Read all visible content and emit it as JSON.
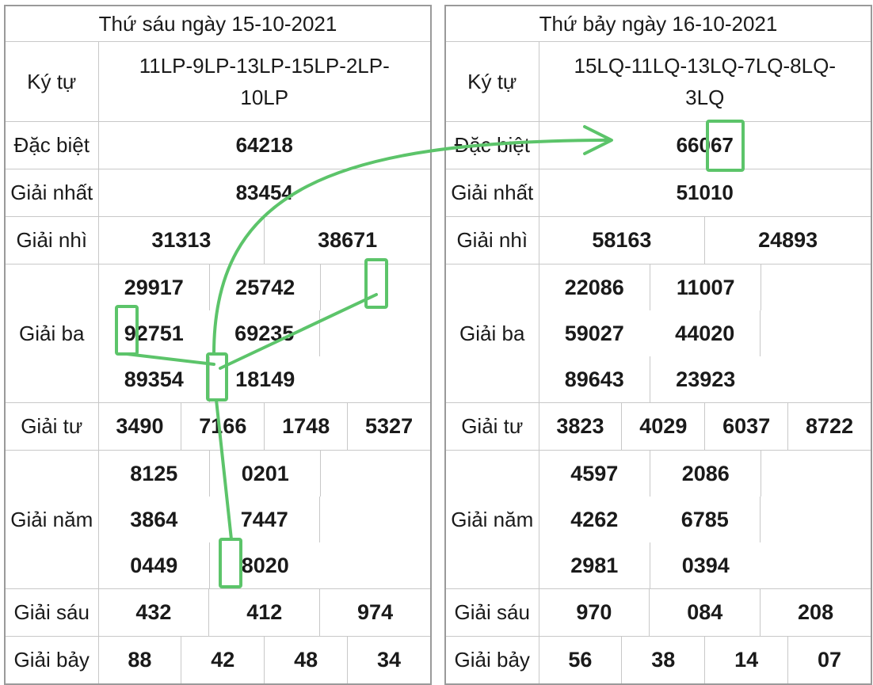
{
  "left": {
    "header": "Thứ sáu ngày 15-10-2021",
    "rows": {
      "kytu": {
        "label": "Ký tự",
        "codes": "11LP-9LP-13LP-15LP-2LP-10LP"
      },
      "dacbiet": {
        "label": "Đặc biệt",
        "values": [
          "64218"
        ]
      },
      "nhat": {
        "label": "Giải nhất",
        "values": [
          "83454"
        ]
      },
      "nhi": {
        "label": "Giải nhì",
        "values": [
          "31313",
          "38671"
        ]
      },
      "ba": {
        "label": "Giải ba",
        "values": [
          "29917",
          "25742",
          "92751",
          "69235",
          "89354",
          "18149"
        ]
      },
      "tu": {
        "label": "Giải tư",
        "values": [
          "3490",
          "7166",
          "1748",
          "5327"
        ]
      },
      "nam": {
        "label": "Giải năm",
        "values": [
          "8125",
          "0201",
          "3864",
          "7447",
          "0449",
          "8020"
        ]
      },
      "sau": {
        "label": "Giải sáu",
        "values": [
          "432",
          "412",
          "974"
        ]
      },
      "bay": {
        "label": "Giải bảy",
        "values": [
          "88",
          "42",
          "48",
          "34"
        ]
      }
    }
  },
  "right": {
    "header": "Thứ bảy ngày 16-10-2021",
    "rows": {
      "kytu": {
        "label": "Ký tự",
        "codes": "15LQ-11LQ-13LQ-7LQ-8LQ-3LQ"
      },
      "dacbiet": {
        "label": "Đặc biệt",
        "values": [
          "66067"
        ]
      },
      "nhat": {
        "label": "Giải nhất",
        "values": [
          "51010"
        ]
      },
      "nhi": {
        "label": "Giải nhì",
        "values": [
          "58163",
          "24893"
        ]
      },
      "ba": {
        "label": "Giải ba",
        "values": [
          "22086",
          "11007",
          "59027",
          "44020",
          "89643",
          "23923"
        ]
      },
      "tu": {
        "label": "Giải tư",
        "values": [
          "3823",
          "4029",
          "6037",
          "8722"
        ]
      },
      "nam": {
        "label": "Giải năm",
        "values": [
          "4597",
          "2086",
          "4262",
          "6785",
          "2981",
          "0394"
        ]
      },
      "sau": {
        "label": "Giải sáu",
        "values": [
          "970",
          "084",
          "208"
        ]
      },
      "bay": {
        "label": "Giải bảy",
        "values": [
          "56",
          "38",
          "14",
          "07"
        ]
      }
    }
  },
  "colors": {
    "special": "#d42a1f",
    "annotation": "#5cc46a",
    "border": "#c8c8c8"
  }
}
